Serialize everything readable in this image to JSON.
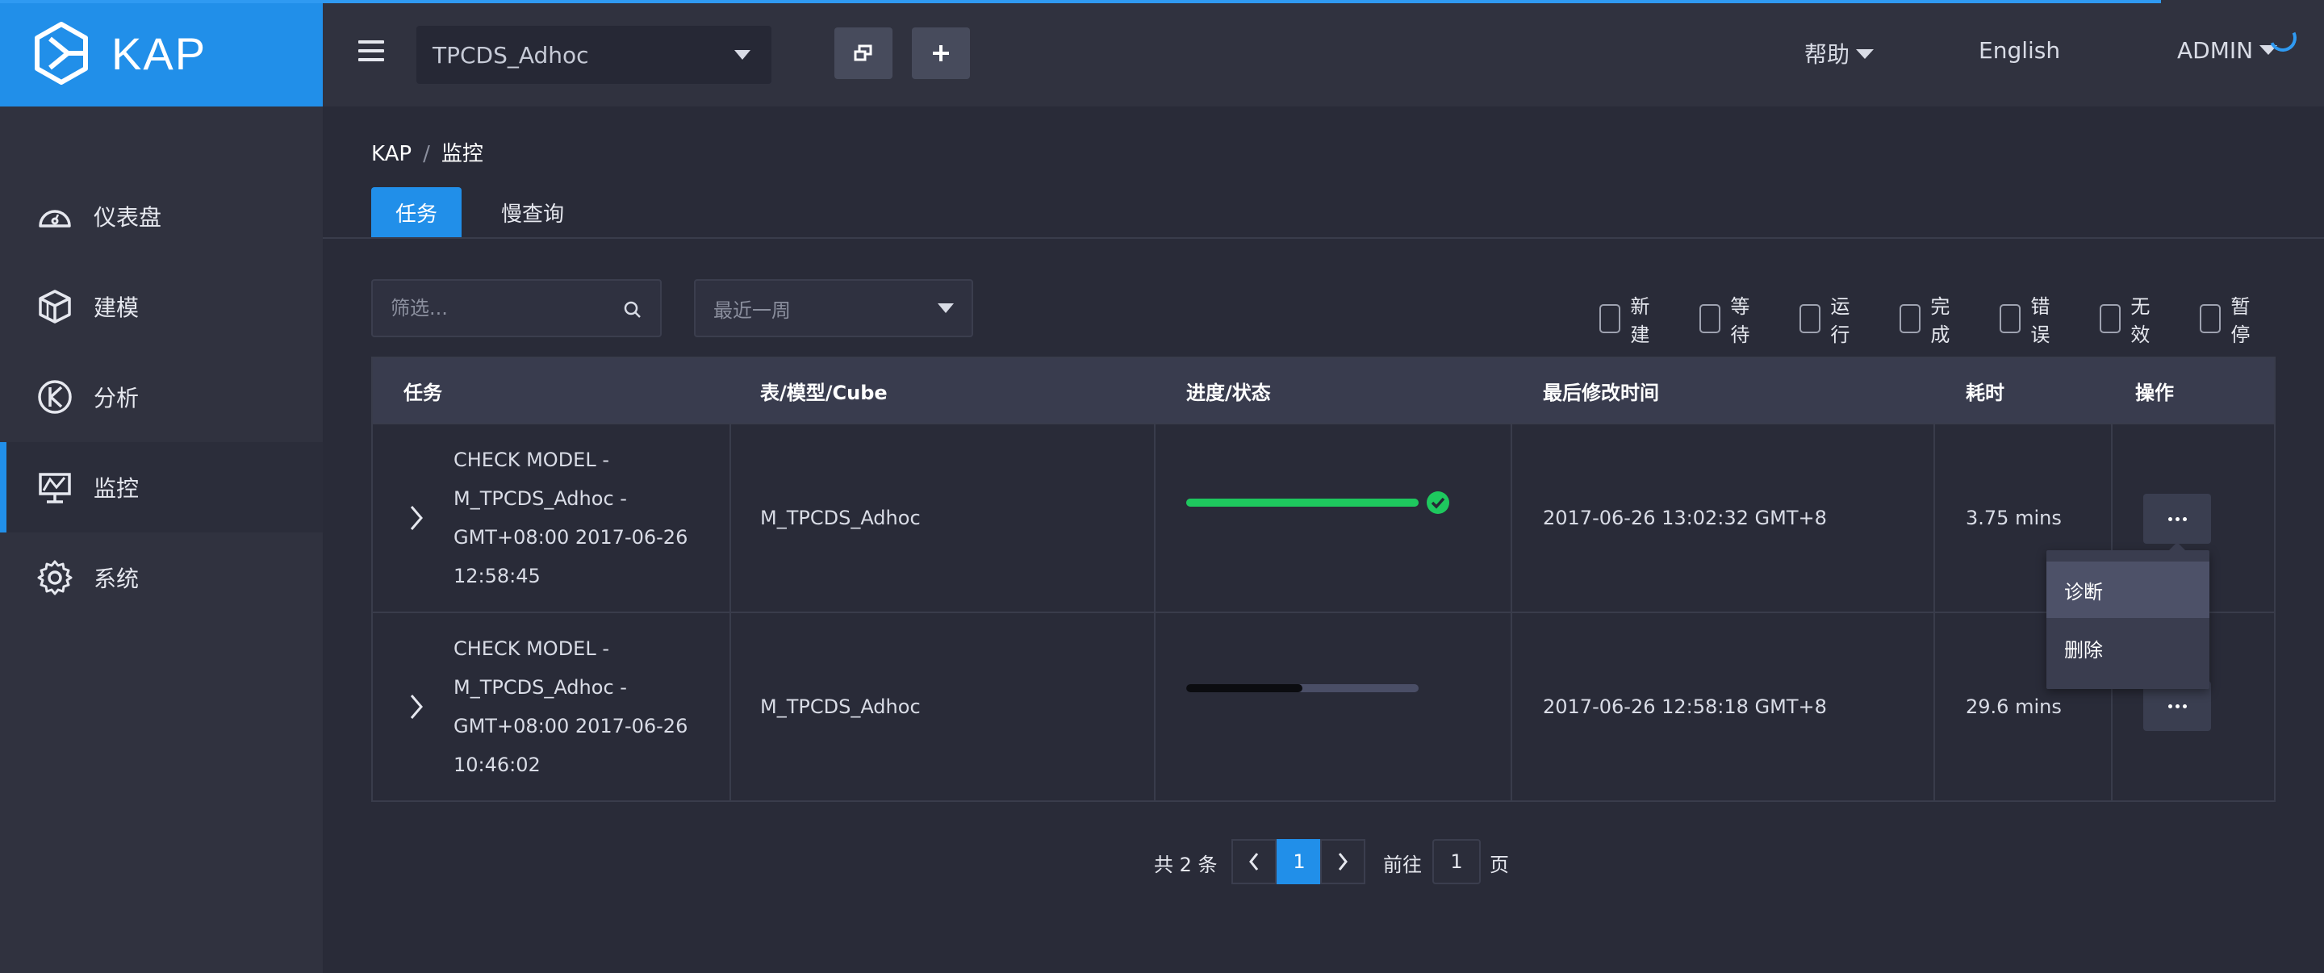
{
  "brand": {
    "name": "KAP"
  },
  "header": {
    "project": "TPCDS_Adhoc",
    "help_label": "帮助",
    "language_label": "English",
    "user_label": "ADMIN"
  },
  "sidebar": {
    "items": [
      {
        "label": "仪表盘",
        "icon": "dashboard-icon"
      },
      {
        "label": "建模",
        "icon": "cube-icon"
      },
      {
        "label": "分析",
        "icon": "analysis-icon"
      },
      {
        "label": "监控",
        "icon": "monitor-icon",
        "active": true
      },
      {
        "label": "系统",
        "icon": "gear-icon"
      }
    ]
  },
  "breadcrumb": {
    "root": "KAP",
    "separator": "/",
    "current": "监控"
  },
  "tabs": [
    {
      "label": "任务",
      "active": true
    },
    {
      "label": "慢查询",
      "active": false
    }
  ],
  "filters": {
    "search_placeholder": "筛选...",
    "time_range": "最近一周",
    "status_checks": [
      "新建",
      "等待",
      "运行",
      "完成",
      "错误",
      "无效",
      "暂停"
    ]
  },
  "table": {
    "headers": [
      "任务",
      "表/模型/Cube",
      "进度/状态",
      "最后修改时间",
      "耗时",
      "操作"
    ],
    "rows": [
      {
        "task_lines": [
          "CHECK MODEL -",
          "M_TPCDS_Adhoc -",
          "GMT+08:00 2017-06-26",
          "12:58:45"
        ],
        "model": "M_TPCDS_Adhoc",
        "progress": 1.0,
        "status": "finished",
        "modified": "2017-06-26 13:02:32 GMT+8",
        "duration": "3.75 mins"
      },
      {
        "task_lines": [
          "CHECK MODEL -",
          "M_TPCDS_Adhoc -",
          "GMT+08:00 2017-06-26",
          "10:46:02"
        ],
        "model": "M_TPCDS_Adhoc",
        "progress": 0.5,
        "status": "stopped",
        "modified": "2017-06-26 12:58:18 GMT+8",
        "duration": "29.6 mins"
      }
    ]
  },
  "action_menu": {
    "items": [
      "诊断",
      "删除"
    ]
  },
  "pagination": {
    "total_label": "共 2 条",
    "current_page": "1",
    "goto_label": "前往",
    "goto_value": "1",
    "page_suffix": "页"
  },
  "colors": {
    "accent": "#218fe9",
    "success": "#1ec85e",
    "progress_dark": "#0b0c10",
    "progress_track": "#4a4e66"
  }
}
